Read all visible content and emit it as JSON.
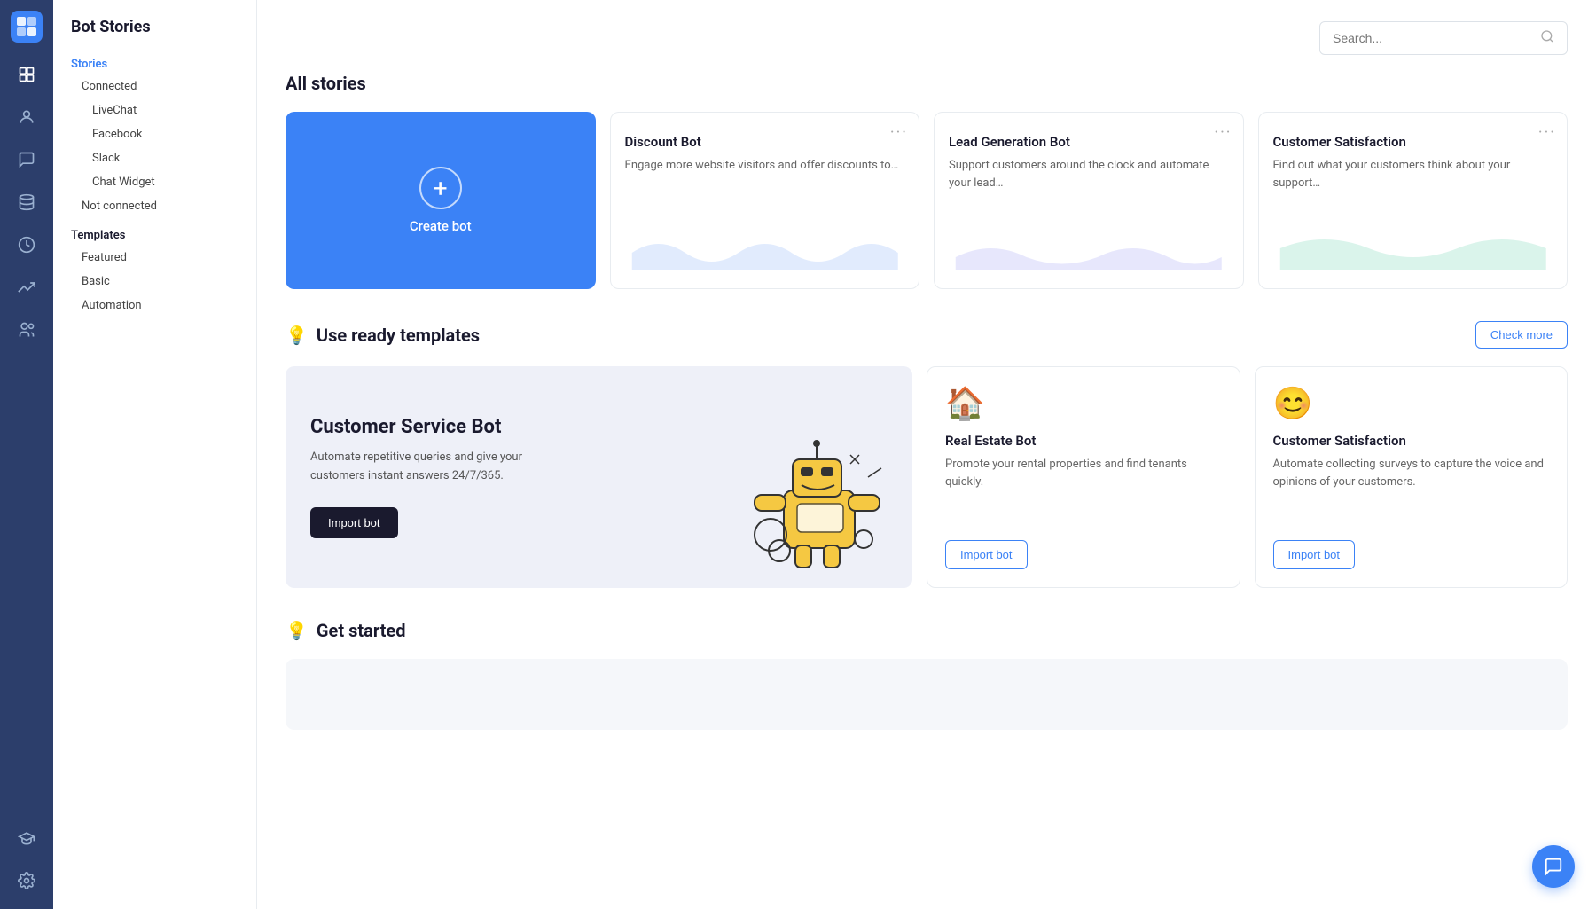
{
  "app": {
    "title": "Bot Stories"
  },
  "nav_icons": [
    {
      "name": "bots-icon",
      "symbol": "⊡",
      "active": false
    },
    {
      "name": "users-icon",
      "symbol": "👤",
      "active": false
    },
    {
      "name": "chat-icon",
      "symbol": "💬",
      "active": false
    },
    {
      "name": "database-icon",
      "symbol": "🗄",
      "active": false
    },
    {
      "name": "clock-icon",
      "symbol": "🕐",
      "active": false
    },
    {
      "name": "analytics-icon",
      "symbol": "📈",
      "active": false
    },
    {
      "name": "team-icon",
      "symbol": "👥",
      "active": false
    },
    {
      "name": "academy-icon",
      "symbol": "🎓",
      "active": false
    },
    {
      "name": "settings-icon",
      "symbol": "⚙",
      "active": false
    }
  ],
  "sidebar": {
    "title": "Bot Stories",
    "sections": [
      {
        "label": "Stories",
        "items": [
          {
            "label": "Connected",
            "sub_items": [
              "LiveChat",
              "Facebook",
              "Slack",
              "Chat Widget"
            ]
          },
          {
            "label": "Not connected"
          }
        ]
      },
      {
        "label": "Templates",
        "items": [
          {
            "label": "Featured"
          },
          {
            "label": "Basic"
          },
          {
            "label": "Automation"
          }
        ]
      }
    ]
  },
  "search": {
    "placeholder": "Search..."
  },
  "main": {
    "all_stories_title": "All stories",
    "create_bot_label": "Create bot",
    "story_cards": [
      {
        "title": "Discount Bot",
        "description": "Engage more website visitors and offer discounts to…"
      },
      {
        "title": "Lead Generation Bot",
        "description": "Support customers around the clock and automate your lead…"
      },
      {
        "title": "Customer Satisfaction",
        "description": "Find out what your customers think about your support…"
      }
    ],
    "templates_section_title": "Use ready templates",
    "check_more_label": "Check more",
    "featured_template": {
      "title": "Customer Service Bot",
      "description": "Automate repetitive queries and give your customers instant answers 24/7/365.",
      "import_label": "Import bot"
    },
    "small_templates": [
      {
        "icon": "🏠",
        "title": "Real Estate Bot",
        "description": "Promote your rental properties and find tenants quickly.",
        "import_label": "Import bot"
      },
      {
        "icon": "😊",
        "title": "Customer Satisfaction",
        "description": "Automate collecting surveys to capture the voice and opinions of your customers.",
        "import_label": "Import bot"
      }
    ],
    "get_started_title": "Get started"
  },
  "floating_chat": {
    "icon": "💬"
  }
}
